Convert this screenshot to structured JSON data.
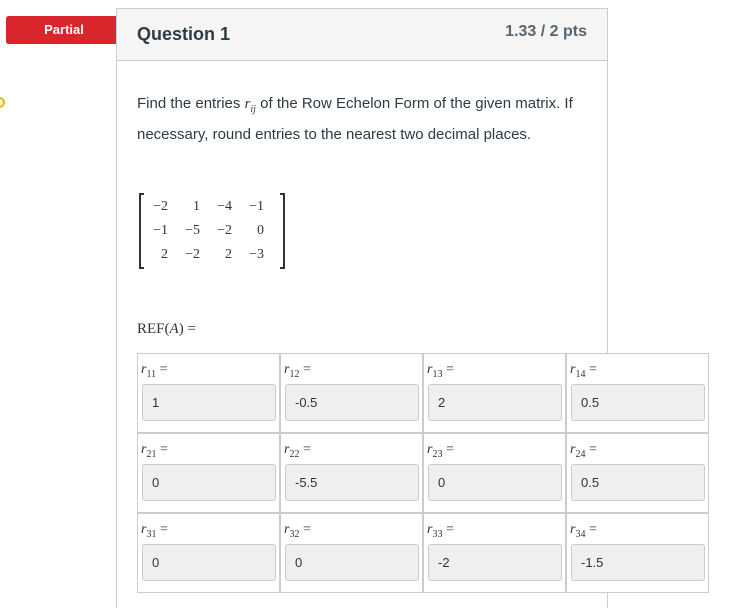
{
  "badge": {
    "label": "Partial",
    "color": "#d9262c"
  },
  "question": {
    "title": "Question 1",
    "points": "1.33 / 2 pts"
  },
  "prompt": {
    "text_before": "Find the entries ",
    "var": "r",
    "var_sub": "ij",
    "text_after": " of the Row Echelon Form of the given matrix.  If necessary, round entries to the nearest two decimal places."
  },
  "matrix": [
    [
      "−2",
      "1",
      "−4",
      "−1"
    ],
    [
      "−1",
      "−5",
      "−2",
      "0"
    ],
    [
      "2",
      "−2",
      "2",
      "−3"
    ]
  ],
  "ref_label": {
    "prefix": "REF(",
    "var": "A",
    "suffix": ") ="
  },
  "answers": [
    [
      {
        "sub": "11",
        "value": "1"
      },
      {
        "sub": "12",
        "value": "-0.5"
      },
      {
        "sub": "13",
        "value": "2"
      },
      {
        "sub": "14",
        "value": "0.5"
      }
    ],
    [
      {
        "sub": "21",
        "value": "0"
      },
      {
        "sub": "22",
        "value": "-5.5"
      },
      {
        "sub": "23",
        "value": "0"
      },
      {
        "sub": "24",
        "value": "0.5"
      }
    ],
    [
      {
        "sub": "31",
        "value": "0"
      },
      {
        "sub": "32",
        "value": "0"
      },
      {
        "sub": "33",
        "value": "-2"
      },
      {
        "sub": "34",
        "value": "-1.5"
      }
    ]
  ],
  "answer_var": "r",
  "equals": "="
}
